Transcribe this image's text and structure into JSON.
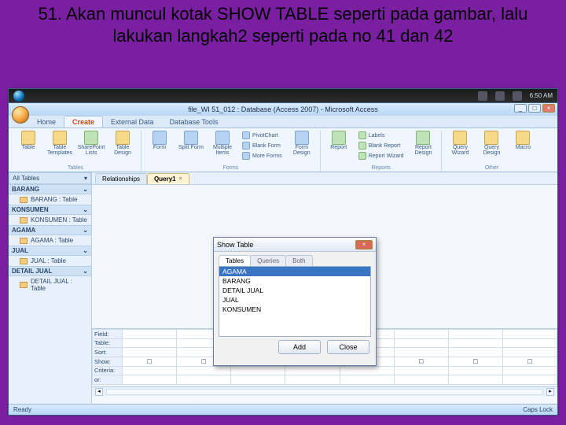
{
  "slide": {
    "title": "51. Akan muncul kotak SHOW TABLE seperti pada gambar, lalu lakukan langkah2 seperti pada no 41 dan 42"
  },
  "taskbar": {
    "clock": "6:50 AM"
  },
  "window": {
    "title": "file_WI 51_012 : Database (Access 2007) - Microsoft Access",
    "min": "_",
    "max": "□",
    "close": "×"
  },
  "tabs": {
    "items": [
      "Home",
      "Create",
      "External Data",
      "Database Tools"
    ],
    "active_index": 1
  },
  "ribbon": {
    "groups": [
      {
        "name": "Tables",
        "buttons": [
          "Table",
          "Table Templates",
          "SharePoint Lists",
          "Table Design"
        ]
      },
      {
        "name": "Forms",
        "buttons": [
          "Form",
          "Split Form",
          "Multiple Items",
          "Form Design"
        ],
        "small": [
          "PivotChart",
          "Blank Form",
          "More Forms"
        ]
      },
      {
        "name": "Reports",
        "buttons": [
          "Report",
          "Report Design"
        ],
        "small": [
          "Labels",
          "Blank Report",
          "Report Wizard"
        ]
      },
      {
        "name": "Other",
        "buttons": [
          "Query Wizard",
          "Query Design",
          "Macro"
        ]
      }
    ]
  },
  "nav": {
    "header": "All Tables",
    "sections": [
      {
        "name": "BARANG",
        "items": [
          "BARANG : Table"
        ]
      },
      {
        "name": "KONSUMEN",
        "items": [
          "KONSUMEN : Table"
        ]
      },
      {
        "name": "AGAMA",
        "items": [
          "AGAMA : Table"
        ]
      },
      {
        "name": "JUAL",
        "items": [
          "JUAL : Table"
        ]
      },
      {
        "name": "DETAIL JUAL",
        "items": [
          "DETAIL JUAL : Table"
        ]
      }
    ]
  },
  "doc_tabs": {
    "items": [
      "Relationships",
      "Query1"
    ],
    "active_index": 1
  },
  "qgrid_rows": [
    "Field:",
    "Table:",
    "Sort:",
    "Show:",
    "Criteria:",
    "or:"
  ],
  "dialog": {
    "title": "Show Table",
    "tabs": [
      "Tables",
      "Queries",
      "Both"
    ],
    "active_tab": 0,
    "items": [
      "AGAMA",
      "BARANG",
      "DETAIL JUAL",
      "JUAL",
      "KONSUMEN"
    ],
    "selected_index": 0,
    "add": "Add",
    "close": "Close"
  },
  "status": {
    "left": "Ready",
    "right": "Caps Lock"
  }
}
